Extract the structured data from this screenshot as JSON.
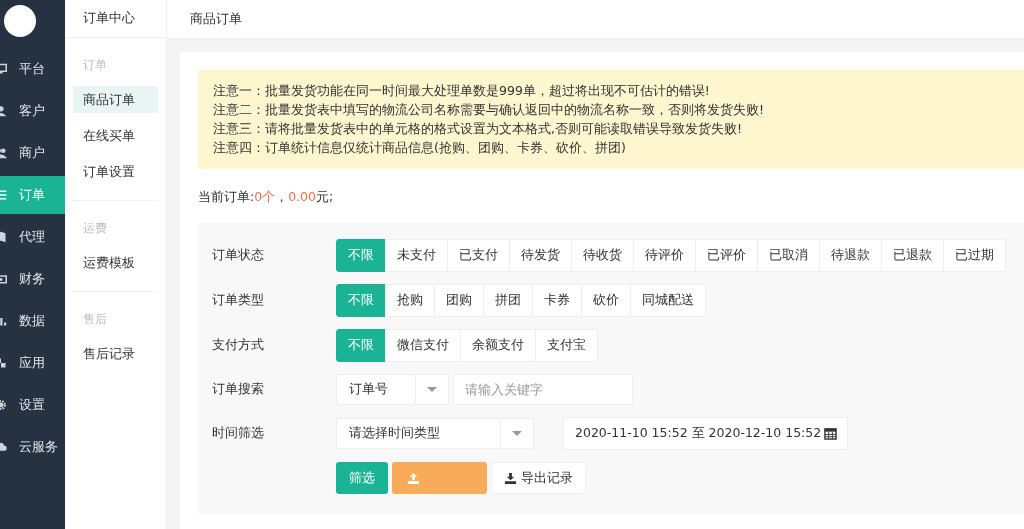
{
  "nav": [
    {
      "label": "平台",
      "selected": false
    },
    {
      "label": "客户",
      "selected": false
    },
    {
      "label": "商户",
      "selected": false
    },
    {
      "label": "订单",
      "selected": true
    },
    {
      "label": "代理",
      "selected": false
    },
    {
      "label": "财务",
      "selected": false
    },
    {
      "label": "数据",
      "selected": false
    },
    {
      "label": "应用",
      "selected": false
    },
    {
      "label": "设置",
      "selected": false
    },
    {
      "label": "云服务",
      "selected": false
    }
  ],
  "subnav": {
    "title": "订单中心",
    "groups": [
      {
        "heading": "订单",
        "items": [
          {
            "label": "商品订单",
            "selected": true
          },
          {
            "label": "在线买单",
            "selected": false
          },
          {
            "label": "订单设置",
            "selected": false
          }
        ]
      },
      {
        "heading": "运费",
        "items": [
          {
            "label": "运费模板",
            "selected": false
          }
        ]
      },
      {
        "heading": "售后",
        "items": [
          {
            "label": "售后记录",
            "selected": false
          }
        ]
      }
    ]
  },
  "breadcrumb": "商品订单",
  "notices": [
    "注意一：批量发货功能在同一时间最大处理单数是999单，超过将出现不可估计的错误!",
    "注意二：批量发货表中填写的物流公司名称需要与确认返回中的物流名称一致，否则将发货失败!",
    "注意三：请将批量发货表中的单元格的格式设置为文本格式,否则可能读取错误导致发货失败!",
    "注意四：订单统计信息仅统计商品信息(抢购、团购、卡券、砍价、拼团)"
  ],
  "summary": {
    "label": "当前订单:",
    "count": "0个",
    "separator": "，",
    "amount": "0.00",
    "unit": "元;"
  },
  "filters": [
    {
      "label": "订单状态",
      "options": [
        {
          "label": "不限",
          "selected": true
        },
        {
          "label": "未支付",
          "selected": false
        },
        {
          "label": "已支付",
          "selected": false
        },
        {
          "label": "待发货",
          "selected": false
        },
        {
          "label": "待收货",
          "selected": false
        },
        {
          "label": "待评价",
          "selected": false
        },
        {
          "label": "已评价",
          "selected": false
        },
        {
          "label": "已取消",
          "selected": false
        },
        {
          "label": "待退款",
          "selected": false
        },
        {
          "label": "已退款",
          "selected": false
        },
        {
          "label": "已过期",
          "selected": false
        }
      ]
    },
    {
      "label": "订单类型",
      "options": [
        {
          "label": "不限",
          "selected": true
        },
        {
          "label": "抢购",
          "selected": false
        },
        {
          "label": "团购",
          "selected": false
        },
        {
          "label": "拼团",
          "selected": false
        },
        {
          "label": "卡券",
          "selected": false
        },
        {
          "label": "砍价",
          "selected": false
        },
        {
          "label": "同城配送",
          "selected": false
        }
      ]
    },
    {
      "label": "支付方式",
      "options": [
        {
          "label": "不限",
          "selected": true
        },
        {
          "label": "微信支付",
          "selected": false
        },
        {
          "label": "余额支付",
          "selected": false
        },
        {
          "label": "支付宝",
          "selected": false
        }
      ]
    }
  ],
  "search": {
    "label": "订单搜索",
    "select": "订单号",
    "placeholder": "请输入关键字"
  },
  "time": {
    "label": "时间筛选",
    "select": "请选择时间类型",
    "range": "2020-11-10 15:52 至 2020-12-10 15:52"
  },
  "actions": [
    {
      "kind": "primary",
      "label": "筛选"
    },
    {
      "kind": "upload"
    },
    {
      "kind": "export",
      "label": "导出记录"
    }
  ]
}
